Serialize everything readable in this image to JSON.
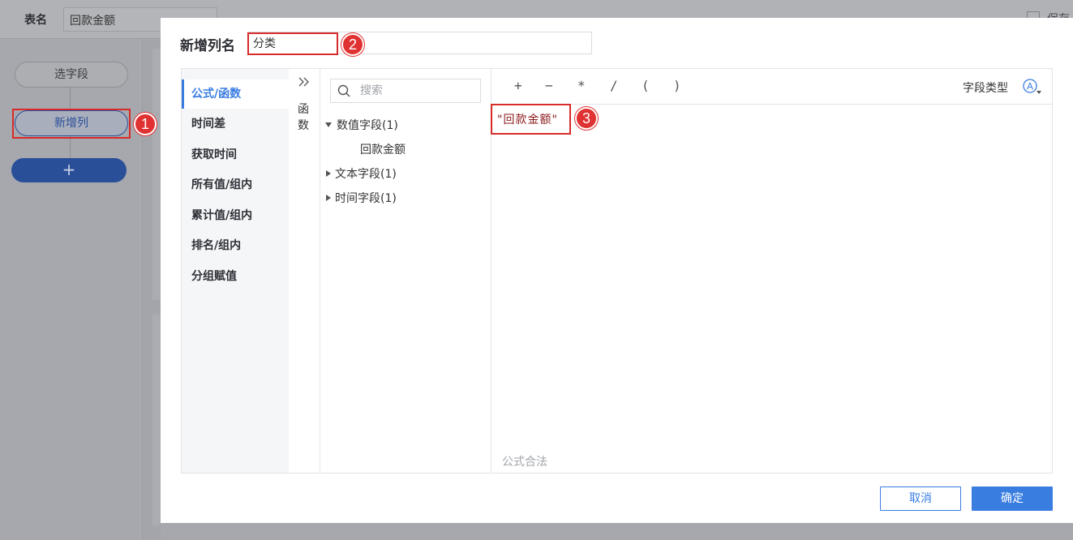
{
  "background": {
    "table_label": "表名",
    "table_name": "回款金额",
    "right_action_partial": "保存",
    "flow_nodes": [
      "选字段",
      "新增列"
    ],
    "add_button": "+"
  },
  "dialog": {
    "title": "新增列名",
    "column_name": "分类",
    "categories": [
      "公式/函数",
      "时间差",
      "获取时间",
      "所有值/组内",
      "累计值/组内",
      "排名/组内",
      "分组赋值"
    ],
    "active_category": "公式/函数",
    "function_panel_label": "函数",
    "search_placeholder": "搜索",
    "field_groups": [
      {
        "label": "数值字段(1)",
        "expanded": true,
        "children": [
          "回款金额"
        ]
      },
      {
        "label": "文本字段(1)",
        "expanded": false
      },
      {
        "label": "时间字段(1)",
        "expanded": false
      }
    ],
    "operators": [
      "+",
      "−",
      "*",
      "/",
      "(",
      ")"
    ],
    "field_type_label": "字段类型",
    "formula_token": "\"回款金额\"",
    "formula_status": "公式合法",
    "cancel_label": "取消",
    "confirm_label": "确定"
  },
  "callouts": [
    "1",
    "2",
    "3"
  ],
  "colors": {
    "accent": "#3a7de1",
    "callout_red": "#e03232",
    "overlay": "#a6a8ad",
    "formula_text": "#8b1a1a"
  }
}
